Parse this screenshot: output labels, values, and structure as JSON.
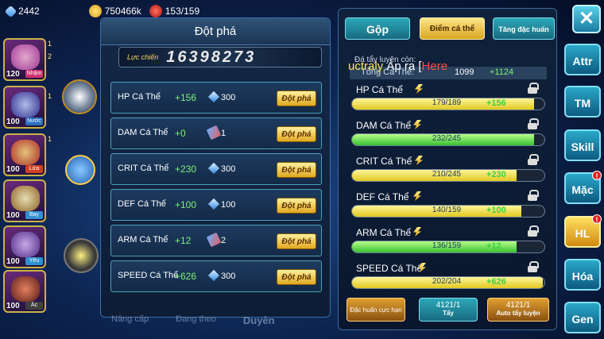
{
  "topbar": {
    "gems": "2442",
    "gold": "750466k",
    "stamina": "153/159"
  },
  "heroes": [
    {
      "level": "120",
      "type": "Nhậm"
    },
    {
      "level": "100",
      "type": "Nước"
    },
    {
      "level": "100",
      "type": "Lửa"
    },
    {
      "level": "100",
      "type": "Bay"
    },
    {
      "level": "100",
      "type": "Yêu"
    },
    {
      "level": "100",
      "type": "Ác"
    }
  ],
  "hero_side_nums": [
    "1",
    "2",
    "1",
    "1"
  ],
  "left_panel": {
    "title": "Đột phá",
    "power_label": "Lực chiến",
    "power_value": "16398273",
    "rows": [
      {
        "name": "HP Cá Thể",
        "add": "+156",
        "cost_icon": "gem-icon",
        "cost": "300",
        "button": "Đột phá"
      },
      {
        "name": "DAM Cá Thể",
        "add": "+0",
        "cost_icon": "scroll-icon",
        "cost": "1",
        "button": "Đột phá"
      },
      {
        "name": "CRIT Cá Thể",
        "add": "+230",
        "cost_icon": "gem-icon",
        "cost": "300",
        "button": "Đột phá"
      },
      {
        "name": "DEF Cá Thể",
        "add": "+100",
        "cost_icon": "gem-icon",
        "cost": "100",
        "button": "Đột phá"
      },
      {
        "name": "ARM Cá Thể",
        "add": "+12",
        "cost_icon": "scroll-icon",
        "cost": "2",
        "button": "Đột phá"
      },
      {
        "name": "SPEED Cá Thể",
        "add": "+626",
        "cost_icon": "gem-icon",
        "cost": "300",
        "button": "Đột phá"
      }
    ],
    "bottom_tabs": [
      "Nâng cấp",
      "Đang theo",
      "Duyên"
    ]
  },
  "right_panel": {
    "tabs": [
      "Gộp",
      "Điểm cá thể",
      "Tăng đặc huấn"
    ],
    "remaining_label": "Đá tẩy luyện còn:",
    "total_label": "Tổng Cá Thể:",
    "total_value": "1099",
    "total_inc": "+1124",
    "overlay": {
      "prefix": "uctraly",
      "mid": " Áp ra [",
      "suffix": "Here"
    },
    "stats": [
      {
        "name": "HP Cá Thể",
        "text": "179/189",
        "inc": "+156",
        "fill_pct": 94.7,
        "fill": "yellow"
      },
      {
        "name": "DAM Cá Thể",
        "text": "232/245",
        "inc": "",
        "fill_pct": 94.7,
        "fill": "green"
      },
      {
        "name": "CRIT Cá Thể",
        "text": "210/245",
        "inc": "+230",
        "fill_pct": 85.7,
        "fill": "yellow"
      },
      {
        "name": "DEF Cá Thể",
        "text": "140/159",
        "inc": "+100",
        "fill_pct": 88.1,
        "fill": "yellow"
      },
      {
        "name": "ARM Cá Thể",
        "text": "136/159",
        "inc": "+12",
        "fill_pct": 85.5,
        "fill": "green"
      },
      {
        "name": "SPEED Cá Thể",
        "text": "202/204",
        "inc": "+626",
        "fill_pct": 99.0,
        "fill": "yellow"
      }
    ],
    "buttons": [
      {
        "label": "Đặc huấn cực hạn",
        "count": ""
      },
      {
        "label": "Tẩy",
        "count": "4121/1"
      },
      {
        "label": "Auto tẩy luyện",
        "count": "4121/1"
      }
    ]
  },
  "side_menu": [
    "Attr",
    "TM",
    "Skill",
    "Mặc",
    "HL",
    "Hóa",
    "Gen"
  ],
  "close_label": "✕"
}
